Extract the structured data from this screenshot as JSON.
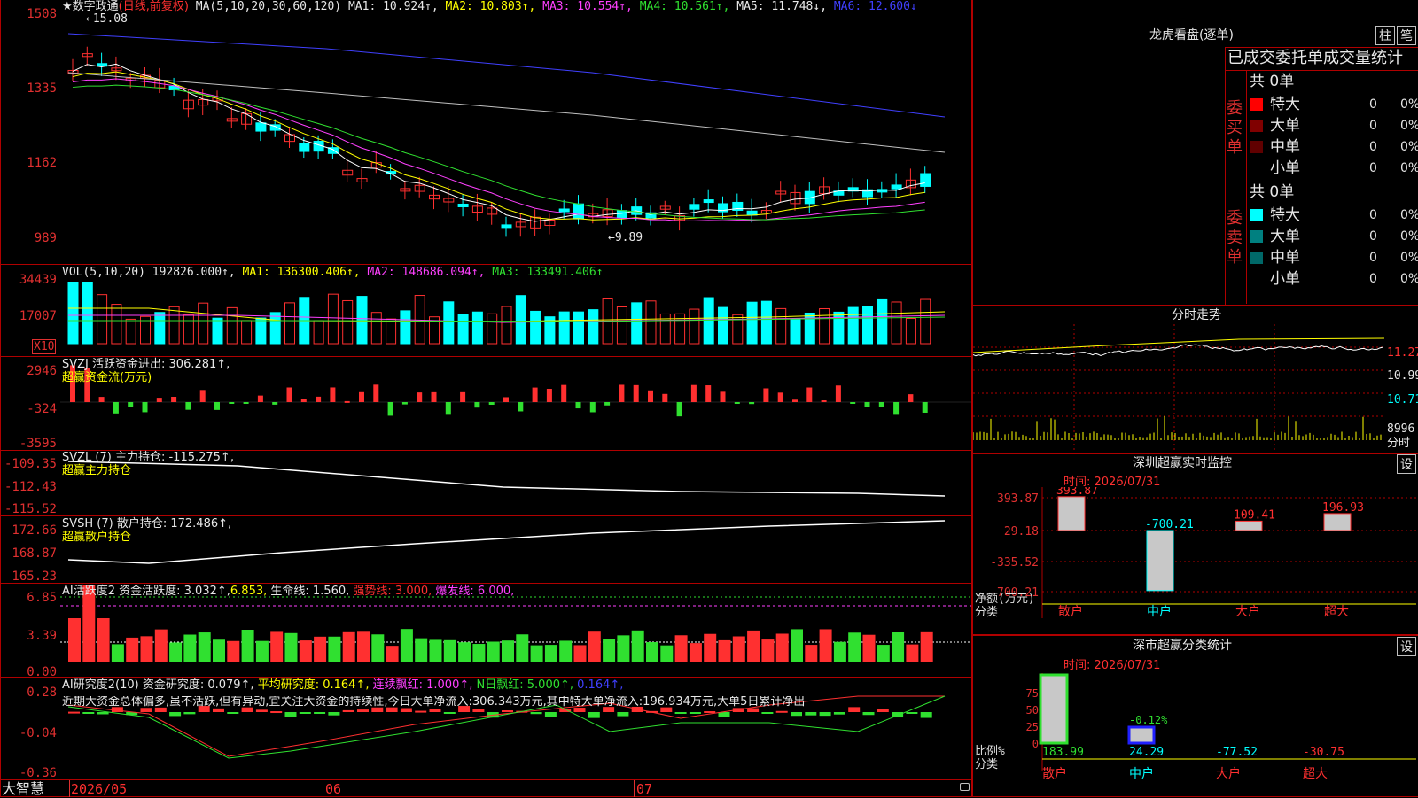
{
  "colors": {
    "bg": "#000000",
    "grid": "#b00000",
    "up": "#ff3030",
    "down": "#00ffff",
    "ma1": "#ffffff",
    "ma2": "#ffff00",
    "ma3": "#ff40ff",
    "ma4": "#30e030",
    "ma5": "#c0c0c0",
    "ma6": "#4040ff"
  },
  "kline": {
    "title": "★数字政通",
    "mode": "(日线,前复权)",
    "ma_label": "MA(5,10,20,30,60,120)",
    "ma1": "MA1: 10.924↑,",
    "ma2": "MA2: 10.803↑,",
    "ma3": "MA3: 10.554↑,",
    "ma4": "MA4: 10.561↑,",
    "ma5": "MA5: 11.748↓,",
    "ma6": "MA6: 12.600↓",
    "high_mark": "15.08",
    "low_mark": "9.89",
    "axis": [
      "1508",
      "1335",
      "1162",
      "989"
    ]
  },
  "vol": {
    "label": "VOL(5,10,20)",
    "val": "192826.000↑,",
    "ma1": "MA1: 136300.406↑,",
    "ma2": "MA2: 148686.094↑,",
    "ma3": "MA3: 133491.406↑",
    "axis": [
      "34439",
      "17007"
    ],
    "unit": "X10"
  },
  "svzj": {
    "label": "SVZJ  活跃资金进出: 306.281↑,",
    "sub": "超赢资金流(万元)",
    "axis": [
      "2946",
      "-324",
      "-3595"
    ]
  },
  "svzl": {
    "label": "SVZL (7) 主力持仓: -115.275↑,",
    "sub": "超赢主力持仓",
    "axis": [
      "-109.35",
      "-112.43",
      "-115.52"
    ]
  },
  "svsh": {
    "label": "SVSH (7) 散户持仓: 172.486↑,",
    "sub": "超赢散户持仓",
    "axis": [
      "172.66",
      "168.87",
      "165.23"
    ]
  },
  "ai1": {
    "label": "AI活跃度2 资金活跃度: 3.032↑,",
    "v2": "6.853,",
    "v3": "生命线: 1.560,",
    "v4": "强势线: 3.000,",
    "v5": "爆发线: 6.000,",
    "axis": [
      "6.85",
      "3.39",
      "0.00"
    ]
  },
  "ai2": {
    "label": "AI研究度2(10) 资金研究度: 0.079↑,",
    "v2": "平均研究度: 0.164↑,",
    "v3": "连续飘红: 1.000↑,",
    "v4": "N日飘红: 5.000↑,",
    "v5": "0.164↑,",
    "note": "近期大资金总体偏多,虽不活跃,但有异动,宜关注大资金的持续性,今日大单净流入:306.343万元,其中特大单净流入:196.934万元,大单5日累计净出",
    "axis": [
      "0.28",
      "-0.04",
      "-0.36"
    ]
  },
  "bottom": {
    "brand": "大智慧",
    "dates": [
      "2026/05",
      "06",
      "07"
    ]
  },
  "dragon": {
    "title": "龙虎看盘(逐单)",
    "btn1": "柱",
    "btn2": "笔",
    "subtitle": "已成交委托单成交量统计",
    "buy": {
      "side": "委买单",
      "total": "共 0单",
      "rows": [
        {
          "name": "特大",
          "n": "0",
          "p": "0%",
          "c": "#ff0000"
        },
        {
          "name": "大单",
          "n": "0",
          "p": "0%",
          "c": "#800000"
        },
        {
          "name": "中单",
          "n": "0",
          "p": "0%",
          "c": "#600000"
        },
        {
          "name": "小单",
          "n": "0",
          "p": "0%",
          "c": ""
        }
      ]
    },
    "sell": {
      "side": "委卖单",
      "total": "共 0单",
      "rows": [
        {
          "name": "特大",
          "n": "0",
          "p": "0%",
          "c": "#00ffff"
        },
        {
          "name": "大单",
          "n": "0",
          "p": "0%",
          "c": "#008080"
        },
        {
          "name": "中单",
          "n": "0",
          "p": "0%",
          "c": "#006868"
        },
        {
          "name": "小单",
          "n": "0",
          "p": "0%",
          "c": ""
        }
      ]
    }
  },
  "intraday": {
    "title": "分时走势",
    "axis": [
      "11.27",
      "10.99",
      "10.71",
      "8996"
    ],
    "unit": "分时"
  },
  "sz_monitor": {
    "title": "深圳超赢实时监控",
    "btn": "设",
    "time": "时间: 2026/07/31",
    "axis": [
      "393.87",
      "29.18",
      "-335.52",
      "-700.21"
    ],
    "bars": [
      {
        "cat": "散户",
        "val": "393.87"
      },
      {
        "cat": "中户",
        "val": "-700.21"
      },
      {
        "cat": "大户",
        "val": "109.41"
      },
      {
        "cat": "超大",
        "val": "196.93"
      }
    ],
    "unit": "净额(万元)",
    "cat_label": "分类"
  },
  "sz_stats": {
    "title": "深市超赢分类统计",
    "btn": "设",
    "time": "时间: 2026/07/31",
    "axis": [
      "75",
      "50",
      "25",
      "0"
    ],
    "top": "-0.12%",
    "vals": [
      "183.99",
      "24.29",
      "-77.52",
      "-30.75"
    ],
    "cats": [
      "散户",
      "中户",
      "大户",
      "超大"
    ],
    "unit": "比例%",
    "cat_label": "分类"
  }
}
